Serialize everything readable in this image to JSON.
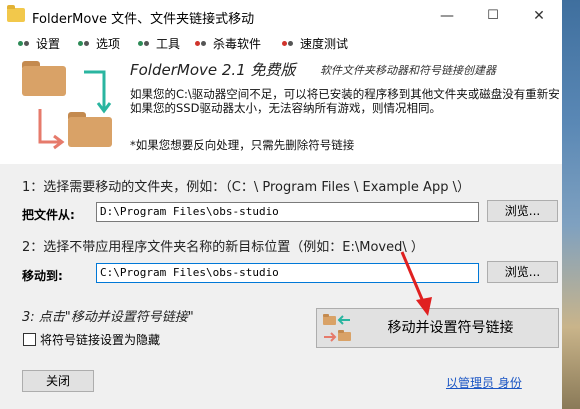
{
  "window": {
    "title": "FolderMove 文件、文件夹链接式移动",
    "controls": {
      "minimize": "—",
      "maximize": "☐",
      "close": "✕"
    }
  },
  "menu": [
    {
      "label": "设置",
      "dots": [
        "#2e8b57",
        "#555555"
      ]
    },
    {
      "label": "选项",
      "dots": [
        "#2e8b57",
        "#555555"
      ]
    },
    {
      "label": "工具",
      "dots": [
        "#2e8b57",
        "#555555"
      ]
    },
    {
      "label": "杀毒软件",
      "dots": [
        "#d0342c",
        "#555555"
      ]
    },
    {
      "label": "速度测试",
      "dots": [
        "#d0342c",
        "#555555"
      ]
    }
  ],
  "banner": {
    "title": "FolderMove 2.1 免费版",
    "subtitle": "软件文件夹移动器和符号链接创建器",
    "desc_line1": "如果您的C:\\驱动器空间不足，可以将已安装的程序移到其他文件夹或磁盘没有重新安",
    "desc_line2": "如果您的SSD驱动器太小，无法容纳所有游戏，则情况相同。",
    "note": "*如果您想要反向处理，只需先删除符号链接"
  },
  "step1": {
    "label": "1：选择需要移动的文件夹，例如：（C：\\ Program Files \\ Example App \\）",
    "field_label": "把文件从:",
    "value": "D:\\Program Files\\obs-studio",
    "browse": "浏览..."
  },
  "step2": {
    "label": "2：选择不带应用程序文件夹名称的新目标位置（例如：E:\\Moved\\ ）",
    "field_label": "移动到:",
    "value": "C:\\Program Files\\obs-studio",
    "browse": "浏览..."
  },
  "step3": {
    "label": "3: 点击\"移动并设置符号链接\"",
    "move_button": "移动并设置符号链接",
    "hide_checkbox_label": "将符号链接设置为隐藏",
    "hide_checked": false
  },
  "footer": {
    "close": "关闭",
    "link": "以管理员 身份"
  },
  "colors": {
    "accent_red": "#e02020",
    "folder_orange": "#d9a267",
    "folder_tab": "#c48a4f",
    "teal": "#2ab5a0",
    "salmon": "#e67a6b"
  }
}
